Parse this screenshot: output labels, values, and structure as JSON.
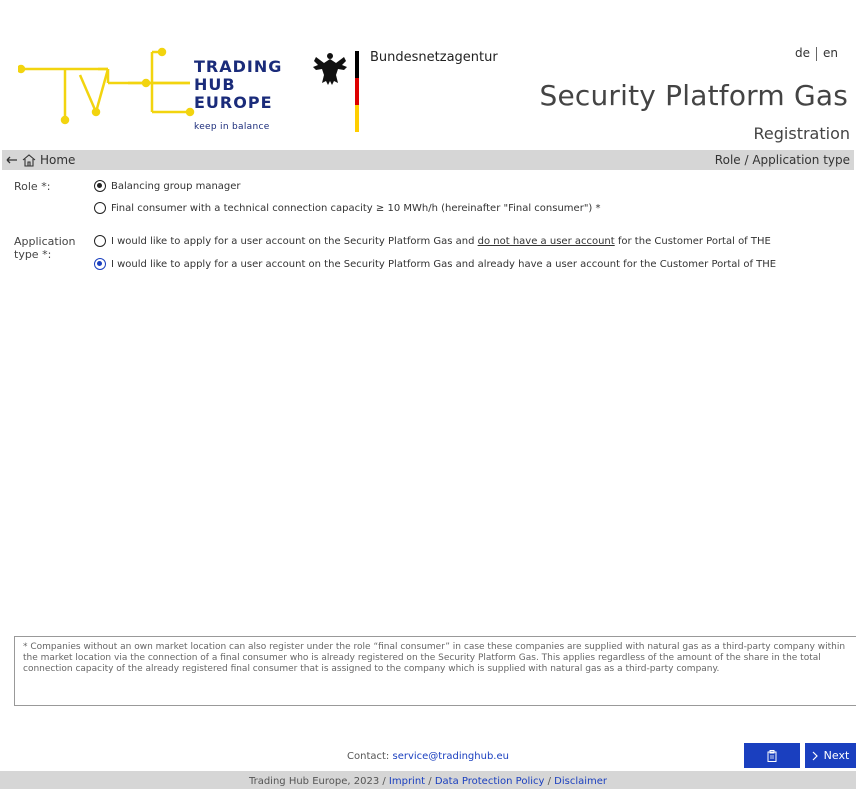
{
  "header": {
    "the_logo": {
      "line1": "TRADING",
      "line2": "HUB",
      "line3": "EUROPE",
      "tagline": "keep in balance",
      "color_yellow": "#f2d40f",
      "color_blue": "#1a2b7a"
    },
    "bna_name": "Bundesnetzagentur",
    "lang": {
      "de": "de",
      "en": "en"
    },
    "title": "Security Platform Gas",
    "subtitle": "Registration"
  },
  "nav": {
    "home_label": "Home",
    "breadcrumb": "Role / Application type"
  },
  "form": {
    "role_label": "Role *:",
    "role_options": [
      {
        "label": "Balancing group manager",
        "checked": true
      },
      {
        "label": "Final consumer with a technical connection capacity ≥ 10 MWh/h (hereinafter \"Final consumer\") *",
        "checked": false
      }
    ],
    "app_type_label_1": "Application",
    "app_type_label_2": "type *:",
    "app_options": [
      {
        "pre": "I would like to apply for a user account on the Security Platform Gas and ",
        "underlined": "do not have a user account",
        "post": " for the Customer Portal of THE",
        "checked": false
      },
      {
        "label": "I would like to apply for a user account on the Security Platform Gas and already have a user account for the Customer Portal of THE",
        "checked": true
      }
    ]
  },
  "note": "* Companies without an own market location can also register under the role “final consumer” in case these companies are supplied with natural gas as a third-party company within the market location via the connection of a final consumer who is already registered on the Security Platform Gas. This applies regardless of the amount of the share in the total connection capacity of the already registered final consumer that is assigned to the company which is supplied with natural gas as a third-party company.",
  "buttons": {
    "clipboard_icon": "clipboard-icon",
    "next_label": "Next"
  },
  "footer": {
    "contact_prefix": "Contact: ",
    "contact_email": "service@tradinghub.eu",
    "copyright": "Trading Hub Europe, 2023 / ",
    "imprint": "Imprint",
    "sep": " / ",
    "data_protection": "Data Protection Policy",
    "disclaimer": "Disclaimer"
  },
  "colors": {
    "accent": "#1a3fbf",
    "bar": "#d6d6d6"
  }
}
